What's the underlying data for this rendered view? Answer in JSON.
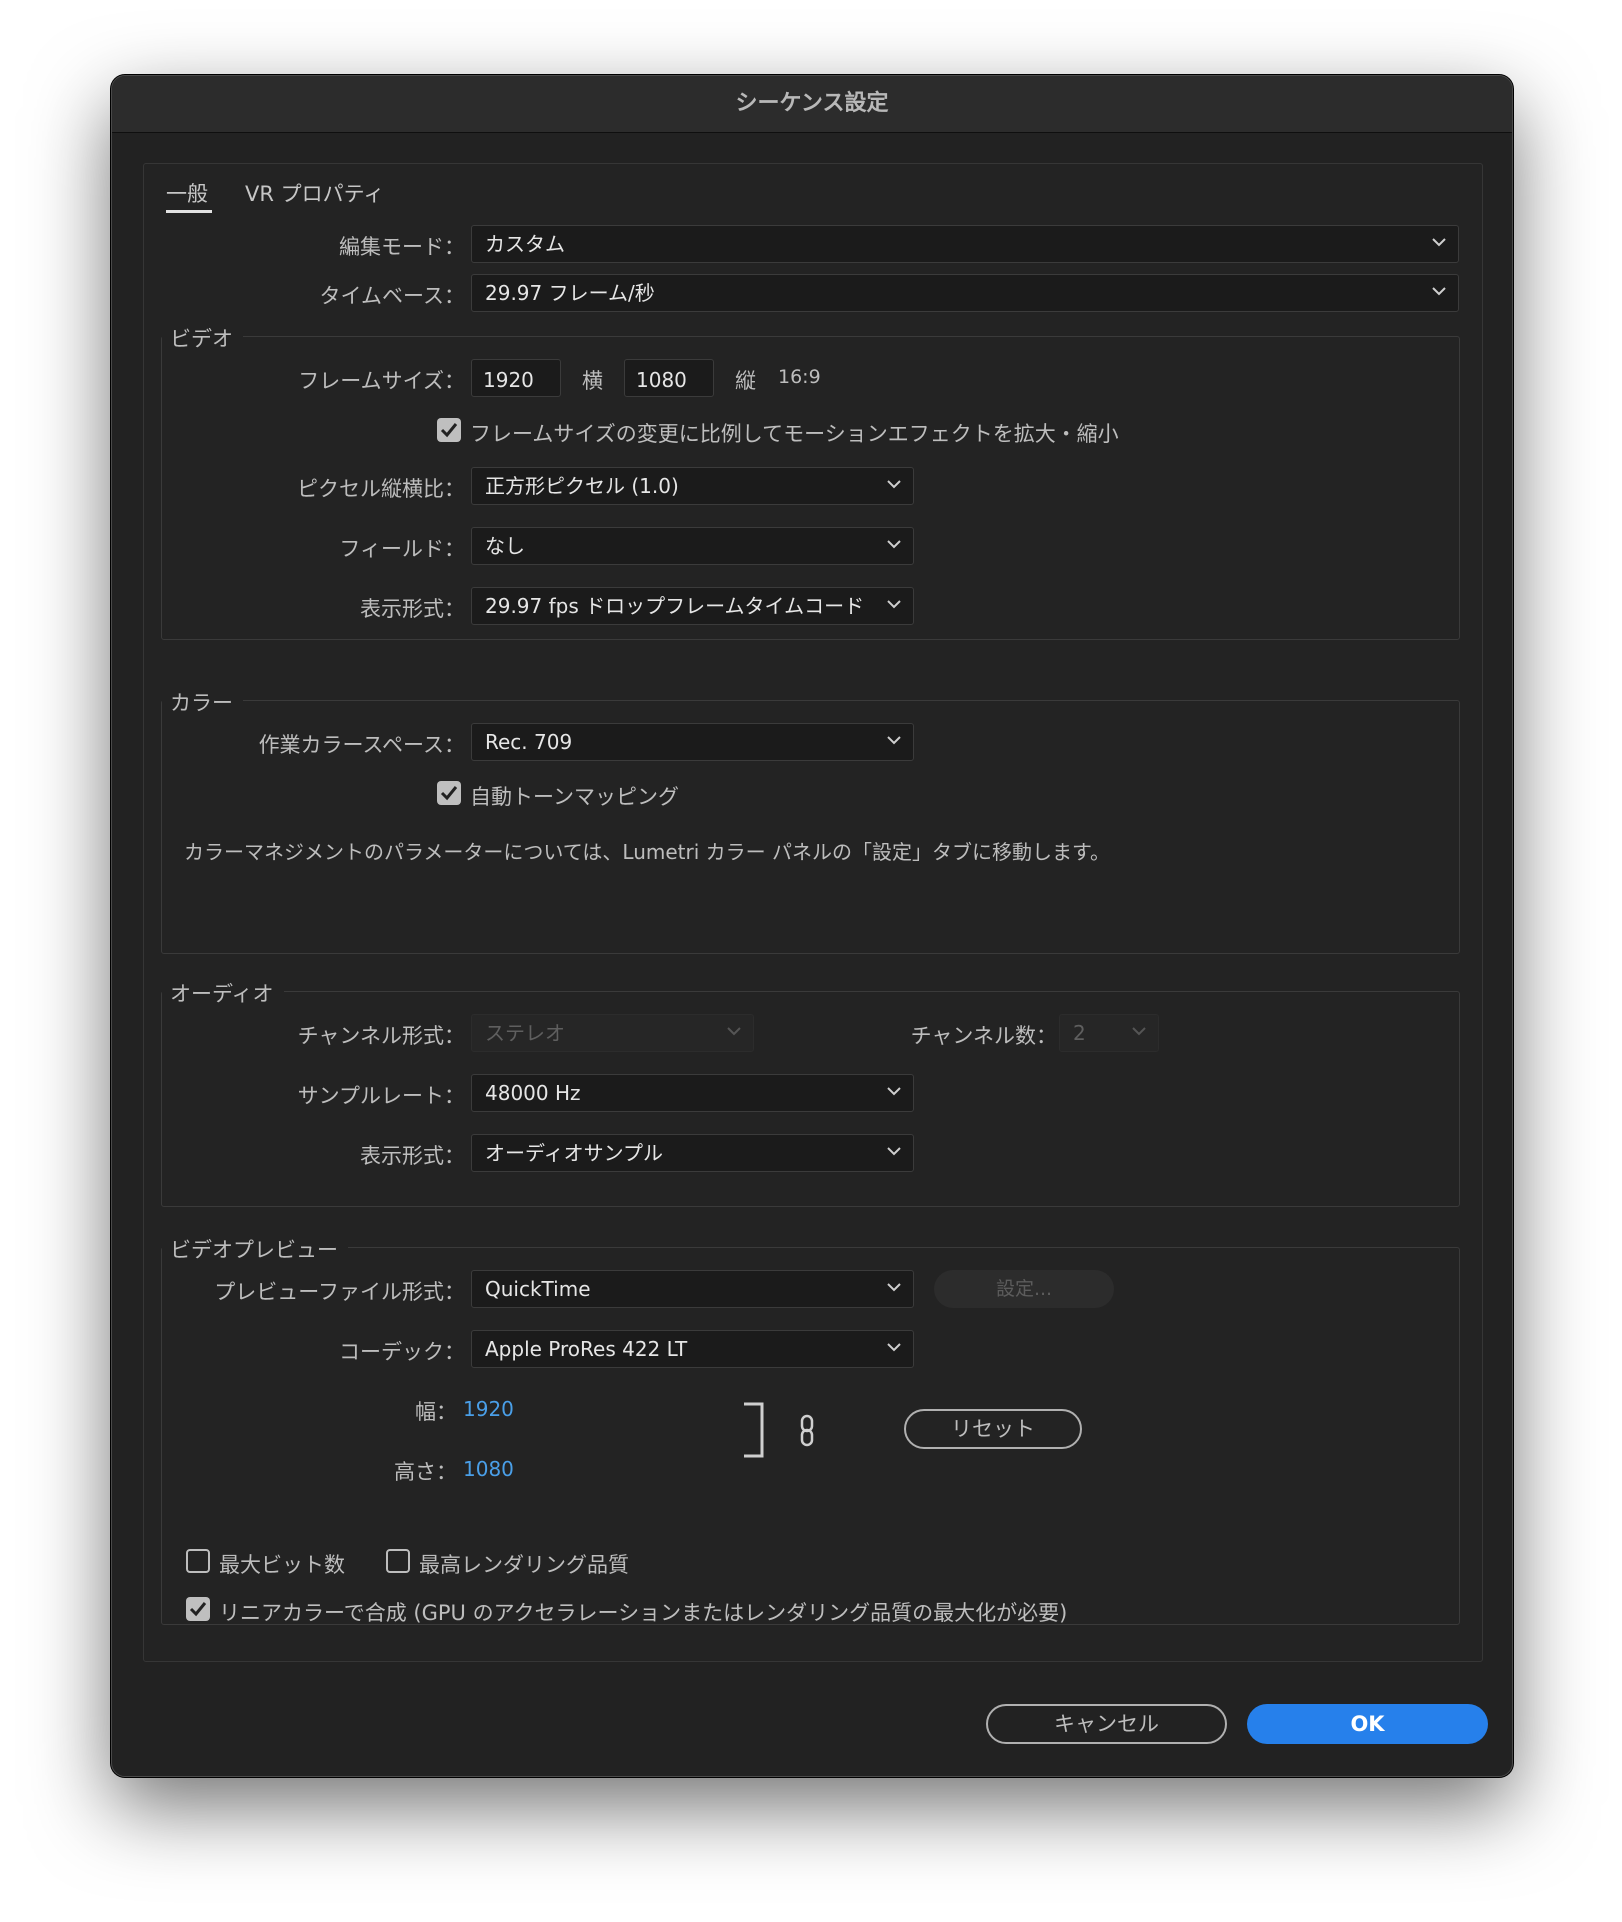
{
  "window": {
    "title": "シーケンス設定"
  },
  "tabs": [
    {
      "label": "一般",
      "active": true
    },
    {
      "label": "VR プロパティ",
      "active": false
    }
  ],
  "general": {
    "edit_mode_label": "編集モード：",
    "edit_mode_value": "カスタム",
    "timebase_label": "タイムベース：",
    "timebase_value": "29.97  フレーム/秒"
  },
  "video": {
    "title": "ビデオ",
    "frame_size_label": "フレームサイズ：",
    "width_value": "1920",
    "horizontal_label": "横",
    "height_value": "1080",
    "vertical_label": "縦",
    "aspect_ratio": "16:9",
    "scale_motion_checked": true,
    "scale_motion_label": "フレームサイズの変更に比例してモーションエフェクトを拡大・縮小",
    "pixel_aspect_label": "ピクセル縦横比：",
    "pixel_aspect_value": "正方形ピクセル (1.0)",
    "fields_label": "フィールド：",
    "fields_value": "なし",
    "display_format_label": "表示形式：",
    "display_format_value": "29.97 fps ドロップフレームタイムコード"
  },
  "color": {
    "title": "カラー",
    "working_space_label": "作業カラースペース：",
    "working_space_value": "Rec. 709",
    "auto_tone_checked": true,
    "auto_tone_label": "自動トーンマッピング",
    "note": "カラーマネジメントのパラメーターについては、Lumetri カラー パネルの「設定」タブに移動します。"
  },
  "audio": {
    "title": "オーディオ",
    "channel_format_label": "チャンネル形式：",
    "channel_format_value": "ステレオ",
    "channel_count_label": "チャンネル数：",
    "channel_count_value": "2",
    "sample_rate_label": "サンプルレート：",
    "sample_rate_value": "48000 Hz",
    "display_format_label": "表示形式：",
    "display_format_value": "オーディオサンプル"
  },
  "preview": {
    "title": "ビデオプレビュー",
    "file_format_label": "プレビューファイル形式：",
    "file_format_value": "QuickTime",
    "settings_button": "設定...",
    "codec_label": "コーデック：",
    "codec_value": "Apple ProRes 422 LT",
    "width_label": "幅：",
    "width_value": "1920",
    "height_label": "高さ：",
    "height_value": "1080",
    "reset_button": "リセット",
    "max_bit_depth_checked": false,
    "max_bit_depth_label": "最大ビット数",
    "max_render_quality_checked": false,
    "max_render_quality_label": "最高レンダリング品質",
    "linear_color_checked": true,
    "linear_color_label": "リニアカラーで合成 (GPU のアクセラレーションまたはレンダリング品質の最大化が必要)"
  },
  "footer": {
    "cancel_label": "キャンセル",
    "ok_label": "OK"
  },
  "colors": {
    "background": "#222222",
    "accent": "#2680eb",
    "link_value": "#4a9fe8"
  }
}
